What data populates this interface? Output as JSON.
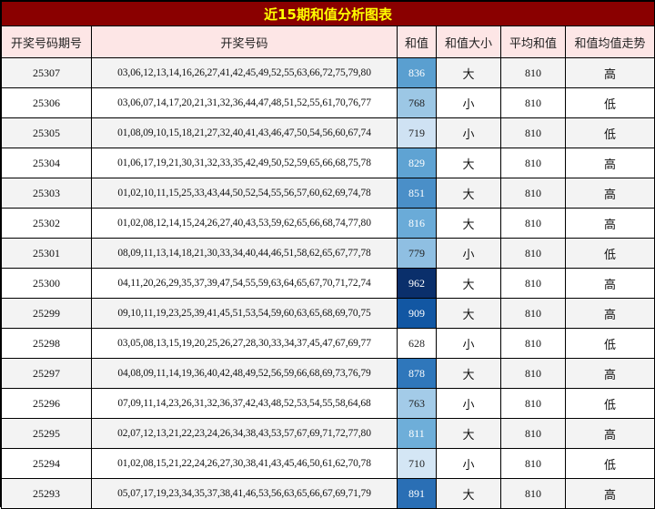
{
  "title": "近15期和值分析图表",
  "headers": [
    "开奖号码期号",
    "开奖号码",
    "和值",
    "和值大小",
    "平均和值",
    "和值均值走势"
  ],
  "rows": [
    {
      "issue": "25307",
      "numbers": "03,06,12,13,14,16,26,27,41,42,45,49,52,55,63,66,72,75,79,80",
      "sum": "836",
      "size": "大",
      "avg": "810",
      "trend": "高",
      "sum_bg": "#5a9fd0",
      "sum_fg": "#ffffff"
    },
    {
      "issue": "25306",
      "numbers": "03,06,07,14,17,20,21,31,32,36,44,47,48,51,52,55,61,70,76,77",
      "sum": "768",
      "size": "小",
      "avg": "810",
      "trend": "低",
      "sum_bg": "#9cc7e5",
      "sum_fg": "#222222"
    },
    {
      "issue": "25305",
      "numbers": "01,08,09,10,15,18,21,27,32,40,41,43,46,47,50,54,56,60,67,74",
      "sum": "719",
      "size": "小",
      "avg": "810",
      "trend": "低",
      "sum_bg": "#cfe2f3",
      "sum_fg": "#222222"
    },
    {
      "issue": "25304",
      "numbers": "01,06,17,19,21,30,31,32,33,35,42,49,50,52,59,65,66,68,75,78",
      "sum": "829",
      "size": "大",
      "avg": "810",
      "trend": "高",
      "sum_bg": "#5fa3d3",
      "sum_fg": "#ffffff"
    },
    {
      "issue": "25303",
      "numbers": "01,02,10,11,15,25,33,43,44,50,52,54,55,56,57,60,62,69,74,78",
      "sum": "851",
      "size": "大",
      "avg": "810",
      "trend": "高",
      "sum_bg": "#4a8fc8",
      "sum_fg": "#ffffff"
    },
    {
      "issue": "25302",
      "numbers": "01,02,08,12,14,15,24,26,27,40,43,53,59,62,65,66,68,74,77,80",
      "sum": "816",
      "size": "大",
      "avg": "810",
      "trend": "高",
      "sum_bg": "#6aabd8",
      "sum_fg": "#ffffff"
    },
    {
      "issue": "25301",
      "numbers": "08,09,11,13,14,18,21,30,33,34,40,44,46,51,58,62,65,67,77,78",
      "sum": "779",
      "size": "小",
      "avg": "810",
      "trend": "低",
      "sum_bg": "#8fbfe2",
      "sum_fg": "#222222"
    },
    {
      "issue": "25300",
      "numbers": "04,11,20,26,29,35,37,39,47,54,55,59,63,64,65,67,70,71,72,74",
      "sum": "962",
      "size": "大",
      "avg": "810",
      "trend": "高",
      "sum_bg": "#0a2f6b",
      "sum_fg": "#ffffff"
    },
    {
      "issue": "25299",
      "numbers": "09,10,11,19,23,25,39,41,45,51,53,54,59,60,63,65,68,69,70,75",
      "sum": "909",
      "size": "大",
      "avg": "810",
      "trend": "高",
      "sum_bg": "#1257a3",
      "sum_fg": "#ffffff"
    },
    {
      "issue": "25298",
      "numbers": "03,05,08,13,15,19,20,25,26,27,28,30,33,34,37,45,47,67,69,77",
      "sum": "628",
      "size": "小",
      "avg": "810",
      "trend": "低",
      "sum_bg": "#ffffff",
      "sum_fg": "#222222"
    },
    {
      "issue": "25297",
      "numbers": "04,08,09,11,14,19,36,40,42,48,49,52,56,59,66,68,69,73,76,79",
      "sum": "878",
      "size": "大",
      "avg": "810",
      "trend": "高",
      "sum_bg": "#2f77bb",
      "sum_fg": "#ffffff"
    },
    {
      "issue": "25296",
      "numbers": "07,09,11,14,23,26,31,32,36,37,42,43,48,52,53,54,55,58,64,68",
      "sum": "763",
      "size": "小",
      "avg": "810",
      "trend": "低",
      "sum_bg": "#a3cbe8",
      "sum_fg": "#222222"
    },
    {
      "issue": "25295",
      "numbers": "02,07,12,13,21,22,23,24,26,34,38,43,53,57,67,69,71,72,77,80",
      "sum": "811",
      "size": "大",
      "avg": "810",
      "trend": "高",
      "sum_bg": "#6eaed9",
      "sum_fg": "#ffffff"
    },
    {
      "issue": "25294",
      "numbers": "01,02,08,15,21,22,24,26,27,30,38,41,43,45,46,50,61,62,70,78",
      "sum": "710",
      "size": "小",
      "avg": "810",
      "trend": "低",
      "sum_bg": "#d4e6f5",
      "sum_fg": "#222222"
    },
    {
      "issue": "25293",
      "numbers": "05,07,17,19,23,34,35,37,38,41,46,53,56,63,65,66,67,69,71,79",
      "sum": "891",
      "size": "大",
      "avg": "810",
      "trend": "高",
      "sum_bg": "#2a6fb5",
      "sum_fg": "#ffffff"
    }
  ]
}
